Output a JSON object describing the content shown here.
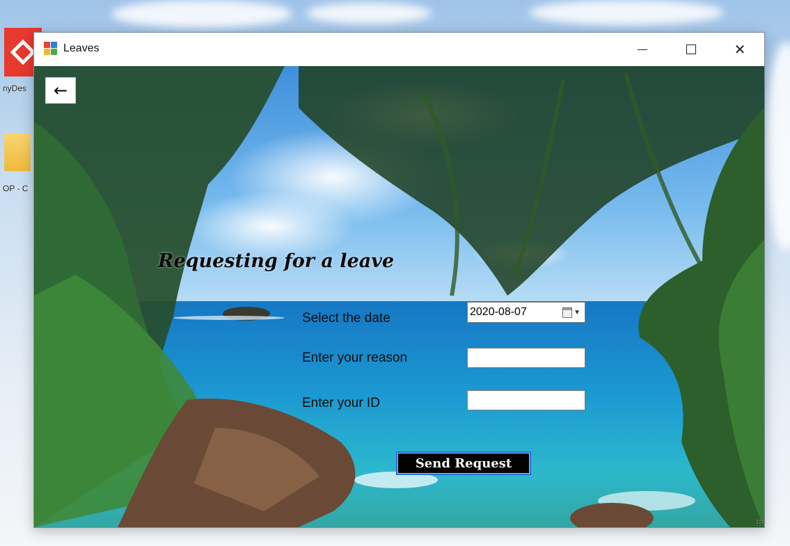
{
  "desktop": {
    "icon1_label": "nyDes",
    "icon2_label": "OP - C"
  },
  "window": {
    "title": "Leaves",
    "minimize_symbol": "—",
    "maximize_symbol": "☐",
    "close_symbol": "✕"
  },
  "form": {
    "back_symbol": "←",
    "heading": "Requesting for a leave",
    "date_label": "Select the date",
    "date_value": "2020-08-07",
    "reason_label": "Enter your reason",
    "reason_value": "",
    "id_label": "Enter your ID",
    "id_value": "",
    "send_button": "Send Request"
  },
  "icons": {
    "app": "app-window-icon",
    "back": "arrow-left-icon",
    "calendar": "calendar-icon",
    "dropdown": "chevron-down-icon"
  },
  "colors": {
    "send_button_bg": "#000000",
    "send_button_border": "#2a6fd6",
    "desktop_app_red": "#e8392f"
  }
}
